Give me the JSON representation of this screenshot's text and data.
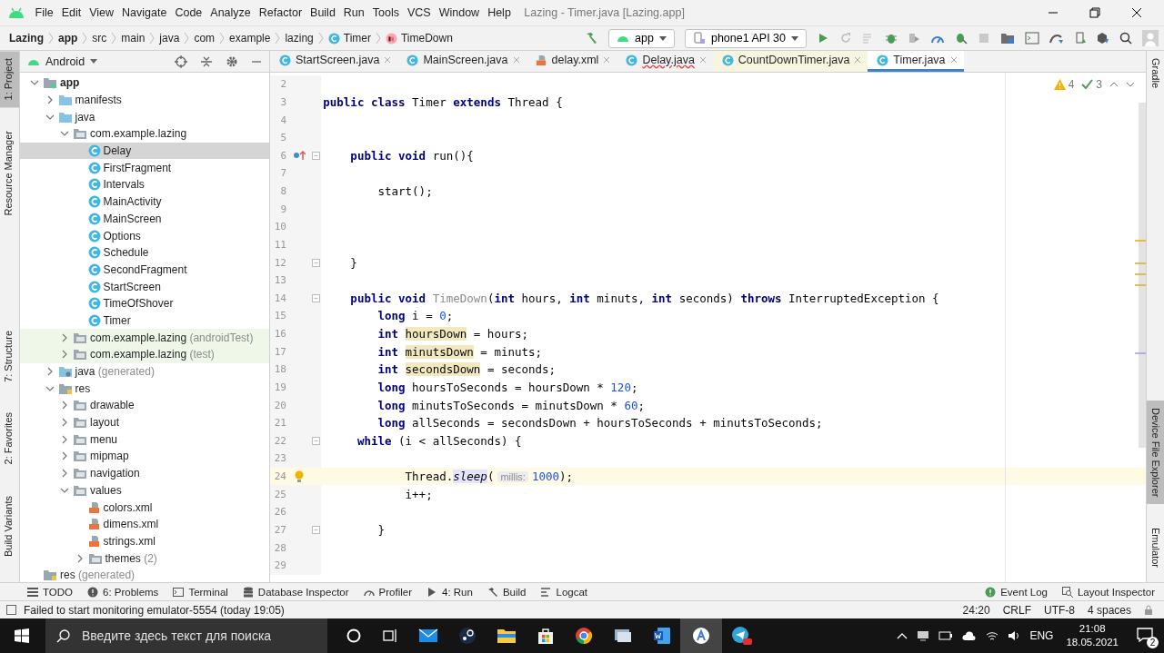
{
  "window": {
    "title": "Lazing - Timer.java [Lazing.app]"
  },
  "menu": [
    "File",
    "Edit",
    "View",
    "Navigate",
    "Code",
    "Analyze",
    "Refactor",
    "Build",
    "Run",
    "Tools",
    "VCS",
    "Window",
    "Help"
  ],
  "breadcrumb": [
    {
      "label": "Lazing",
      "kind": "bold"
    },
    {
      "label": "app",
      "kind": "bold"
    },
    {
      "label": "src",
      "kind": "plain"
    },
    {
      "label": "main",
      "kind": "plain"
    },
    {
      "label": "java",
      "kind": "plain"
    },
    {
      "label": "com",
      "kind": "plain"
    },
    {
      "label": "example",
      "kind": "plain"
    },
    {
      "label": "lazing",
      "kind": "plain"
    },
    {
      "label": "Timer",
      "kind": "class"
    },
    {
      "label": "TimeDown",
      "kind": "method"
    }
  ],
  "toolbar": {
    "run_config": "app",
    "device": "phone1 API 30"
  },
  "left_strip": [
    {
      "label": "1: Project",
      "selected": true
    },
    {
      "label": "Resource Manager",
      "selected": false
    },
    {
      "label": "7: Structure",
      "selected": false
    },
    {
      "label": "2: Favorites",
      "selected": false
    },
    {
      "label": "Build Variants",
      "selected": false
    }
  ],
  "right_strip": [
    {
      "label": "Gradle",
      "selected": false
    },
    {
      "label": "Device File Explorer",
      "selected": true
    },
    {
      "label": "Emulator",
      "selected": false
    }
  ],
  "project": {
    "view": "Android",
    "tree": [
      {
        "label": "app",
        "kind": "module",
        "expanded": true,
        "selected": false,
        "children": [
          {
            "label": "manifests",
            "kind": "folder",
            "expanded": false,
            "selected": false
          },
          {
            "label": "java",
            "kind": "folder",
            "expanded": true,
            "selected": false,
            "children": [
              {
                "label": "com.example.lazing",
                "kind": "package",
                "expanded": true,
                "selected": false,
                "children": [
                  {
                    "label": "Delay",
                    "kind": "class",
                    "selected": true
                  },
                  {
                    "label": "FirstFragment",
                    "kind": "class",
                    "selected": false
                  },
                  {
                    "label": "Intervals",
                    "kind": "class",
                    "selected": false
                  },
                  {
                    "label": "MainActivity",
                    "kind": "class",
                    "selected": false
                  },
                  {
                    "label": "MainScreen",
                    "kind": "class",
                    "selected": false
                  },
                  {
                    "label": "Options",
                    "kind": "class",
                    "selected": false
                  },
                  {
                    "label": "Schedule",
                    "kind": "class",
                    "selected": false
                  },
                  {
                    "label": "SecondFragment",
                    "kind": "class",
                    "selected": false
                  },
                  {
                    "label": "StartScreen",
                    "kind": "class",
                    "selected": false
                  },
                  {
                    "label": "TimeOfShover",
                    "kind": "class",
                    "selected": false
                  },
                  {
                    "label": "Timer",
                    "kind": "class",
                    "selected": false
                  }
                ]
              },
              {
                "label": "com.example.lazing",
                "suffix": "(androidTest)",
                "kind": "package",
                "test_scope": true,
                "expanded": false,
                "selected": false
              },
              {
                "label": "com.example.lazing",
                "suffix": "(test)",
                "kind": "package",
                "test_scope": true,
                "expanded": false,
                "selected": false
              }
            ]
          },
          {
            "label": "java",
            "suffix": "(generated)",
            "kind": "generated",
            "expanded": false,
            "selected": false
          },
          {
            "label": "res",
            "kind": "resources",
            "expanded": true,
            "selected": false,
            "children": [
              {
                "label": "drawable",
                "kind": "package",
                "expanded": false,
                "selected": false
              },
              {
                "label": "layout",
                "kind": "package",
                "expanded": false,
                "selected": false
              },
              {
                "label": "menu",
                "kind": "package",
                "expanded": false,
                "selected": false
              },
              {
                "label": "mipmap",
                "kind": "package",
                "expanded": false,
                "selected": false
              },
              {
                "label": "navigation",
                "kind": "package",
                "expanded": false,
                "selected": false
              },
              {
                "label": "values",
                "kind": "package",
                "expanded": true,
                "selected": false,
                "children": [
                  {
                    "label": "colors.xml",
                    "kind": "xml",
                    "selected": false
                  },
                  {
                    "label": "dimens.xml",
                    "kind": "xml",
                    "selected": false
                  },
                  {
                    "label": "strings.xml",
                    "kind": "xml",
                    "selected": false
                  },
                  {
                    "label": "themes",
                    "suffix": "(2)",
                    "kind": "package",
                    "expanded": false,
                    "selected": false
                  }
                ]
              }
            ]
          }
        ]
      },
      {
        "label": "res",
        "suffix": "(generated)",
        "kind": "resources",
        "selected": false
      }
    ]
  },
  "tabs": [
    {
      "label": "StartScreen.java",
      "kind": "class",
      "selected": false,
      "error": false,
      "tinted": false
    },
    {
      "label": "MainScreen.java",
      "kind": "class",
      "selected": false,
      "error": false,
      "tinted": false
    },
    {
      "label": "delay.xml",
      "kind": "xml",
      "selected": false,
      "error": false,
      "tinted": false
    },
    {
      "label": "Delay.java",
      "kind": "class",
      "selected": false,
      "error": true,
      "tinted": false
    },
    {
      "label": "CountDownTimer.java",
      "kind": "class",
      "selected": false,
      "error": false,
      "tinted": true
    },
    {
      "label": "Timer.java",
      "kind": "class",
      "selected": true,
      "error": false,
      "tinted": false
    }
  ],
  "editor": {
    "warnings": "4",
    "weak_warnings": "3",
    "lines": [
      {
        "number": "2",
        "kind": "code",
        "fold": false,
        "current": false
      },
      {
        "number": "3",
        "kind": "code",
        "fold": false,
        "current": false,
        "tokens": [
          {
            "kind": "kw",
            "text": "public class "
          },
          {
            "kind": "text",
            "text": "Timer "
          },
          {
            "kind": "kw",
            "text": "extends "
          },
          {
            "kind": "text",
            "text": "Thread {"
          }
        ]
      },
      {
        "number": "4",
        "kind": "code",
        "fold": false,
        "current": false
      },
      {
        "number": "5",
        "kind": "code",
        "fold": false,
        "current": false
      },
      {
        "number": "6",
        "kind": "override",
        "fold": true,
        "current": false,
        "tokens": [
          {
            "kind": "kw",
            "text": "    public void "
          },
          {
            "kind": "text",
            "text": "run(){"
          }
        ]
      },
      {
        "number": "7",
        "kind": "code",
        "fold": false,
        "current": false
      },
      {
        "number": "8",
        "kind": "code",
        "fold": false,
        "current": false,
        "tokens": [
          {
            "kind": "text",
            "text": "        start();"
          }
        ]
      },
      {
        "number": "9",
        "kind": "code",
        "fold": false,
        "current": false
      },
      {
        "number": "10",
        "kind": "code",
        "fold": false,
        "current": false
      },
      {
        "number": "11",
        "kind": "code",
        "fold": false,
        "current": false
      },
      {
        "number": "12",
        "kind": "code",
        "fold": true,
        "current": false,
        "tokens": [
          {
            "kind": "text",
            "text": "    }"
          }
        ]
      },
      {
        "number": "13",
        "kind": "code",
        "fold": false,
        "current": false
      },
      {
        "number": "14",
        "kind": "code",
        "fold": true,
        "current": false,
        "tokens": [
          {
            "kind": "kw",
            "text": "    public void "
          },
          {
            "kind": "unused",
            "text": "TimeDown"
          },
          {
            "kind": "text",
            "text": "("
          },
          {
            "kind": "kw",
            "text": "int "
          },
          {
            "kind": "text",
            "text": "hours, "
          },
          {
            "kind": "kw",
            "text": "int "
          },
          {
            "kind": "text",
            "text": "minuts, "
          },
          {
            "kind": "kw",
            "text": "int "
          },
          {
            "kind": "text",
            "text": "seconds) "
          },
          {
            "kind": "kw",
            "text": "throws "
          },
          {
            "kind": "text",
            "text": "InterruptedException {"
          }
        ]
      },
      {
        "number": "15",
        "kind": "code",
        "fold": false,
        "current": false,
        "tokens": [
          {
            "kind": "kw",
            "text": "        long "
          },
          {
            "kind": "text",
            "text": "i = "
          },
          {
            "kind": "num",
            "text": "0"
          },
          {
            "kind": "text",
            "text": ";"
          }
        ]
      },
      {
        "number": "16",
        "kind": "code",
        "fold": false,
        "current": false,
        "tokens": [
          {
            "kind": "kw",
            "text": "        int "
          },
          {
            "kind": "decl",
            "text": "hoursDown"
          },
          {
            "kind": "text",
            "text": " = hours;"
          }
        ]
      },
      {
        "number": "17",
        "kind": "code",
        "fold": false,
        "current": false,
        "tokens": [
          {
            "kind": "kw",
            "text": "        int "
          },
          {
            "kind": "decl",
            "text": "minutsDown"
          },
          {
            "kind": "text",
            "text": " = minuts;"
          }
        ]
      },
      {
        "number": "18",
        "kind": "code",
        "fold": false,
        "current": false,
        "tokens": [
          {
            "kind": "kw",
            "text": "        int "
          },
          {
            "kind": "decl",
            "text": "secondsDown"
          },
          {
            "kind": "text",
            "text": " = seconds;"
          }
        ]
      },
      {
        "number": "19",
        "kind": "code",
        "fold": false,
        "current": false,
        "tokens": [
          {
            "kind": "kw",
            "text": "        long "
          },
          {
            "kind": "text",
            "text": "hoursToSeconds = hoursDown * "
          },
          {
            "kind": "num",
            "text": "120"
          },
          {
            "kind": "text",
            "text": ";"
          }
        ]
      },
      {
        "number": "20",
        "kind": "code",
        "fold": false,
        "current": false,
        "tokens": [
          {
            "kind": "kw",
            "text": "        long "
          },
          {
            "kind": "text",
            "text": "minutsToSeconds = minutsDown * "
          },
          {
            "kind": "num",
            "text": "60"
          },
          {
            "kind": "text",
            "text": ";"
          }
        ]
      },
      {
        "number": "21",
        "kind": "code",
        "fold": false,
        "current": false,
        "tokens": [
          {
            "kind": "kw",
            "text": "        long "
          },
          {
            "kind": "text",
            "text": "allSeconds = secondsDown + hoursToSeconds + minutsToSeconds;"
          }
        ]
      },
      {
        "number": "22",
        "kind": "code",
        "fold": true,
        "current": false,
        "tokens": [
          {
            "kind": "kw",
            "text": "     while "
          },
          {
            "kind": "text",
            "text": "(i < allSeconds) {"
          }
        ]
      },
      {
        "number": "23",
        "kind": "code",
        "fold": false,
        "current": false
      },
      {
        "number": "24",
        "kind": "bulb",
        "fold": false,
        "current": true,
        "tokens": [
          {
            "kind": "text",
            "text": "            Thread."
          },
          {
            "kind": "call",
            "text": "sleep"
          },
          {
            "kind": "text",
            "text": "("
          },
          {
            "kind": "hint",
            "text": "millis:"
          },
          {
            "kind": "num",
            "text": "1000"
          },
          {
            "kind": "text",
            "text": ");"
          }
        ]
      },
      {
        "number": "25",
        "kind": "code",
        "fold": false,
        "current": false,
        "tokens": [
          {
            "kind": "text",
            "text": "            i++;"
          }
        ]
      },
      {
        "number": "26",
        "kind": "code",
        "fold": false,
        "current": false
      },
      {
        "number": "27",
        "kind": "code",
        "fold": true,
        "current": false,
        "tokens": [
          {
            "kind": "text",
            "text": "        }"
          }
        ]
      },
      {
        "number": "28",
        "kind": "code",
        "fold": false,
        "current": false
      },
      {
        "number": "29",
        "kind": "code",
        "fold": false,
        "current": false
      }
    ]
  },
  "tool_tabs": [
    {
      "label": "TODO",
      "kind": "todo"
    },
    {
      "label": "6: Problems",
      "kind": "problems"
    },
    {
      "label": "Terminal",
      "kind": "terminal"
    },
    {
      "label": "Database Inspector",
      "kind": "database"
    },
    {
      "label": "Profiler",
      "kind": "profiler"
    },
    {
      "label": "4: Run",
      "kind": "run"
    },
    {
      "label": "Build",
      "kind": "build"
    },
    {
      "label": "Logcat",
      "kind": "logcat"
    }
  ],
  "tool_tabs_right": [
    {
      "label": "Event Log",
      "kind": "event"
    },
    {
      "label": "Layout Inspector",
      "kind": "inspector"
    }
  ],
  "status_bar": {
    "message": "Failed to start monitoring emulator-5554 (today 19:05)",
    "position": "24:20",
    "line_separator": "CRLF",
    "encoding": "UTF-8",
    "indent": "4 spaces"
  },
  "taskbar": {
    "search": {
      "placeholder": "Введите здесь текст для поиска"
    },
    "language": "ENG",
    "time": "21:08",
    "date": "18.05.2021",
    "notifications": "2"
  }
}
